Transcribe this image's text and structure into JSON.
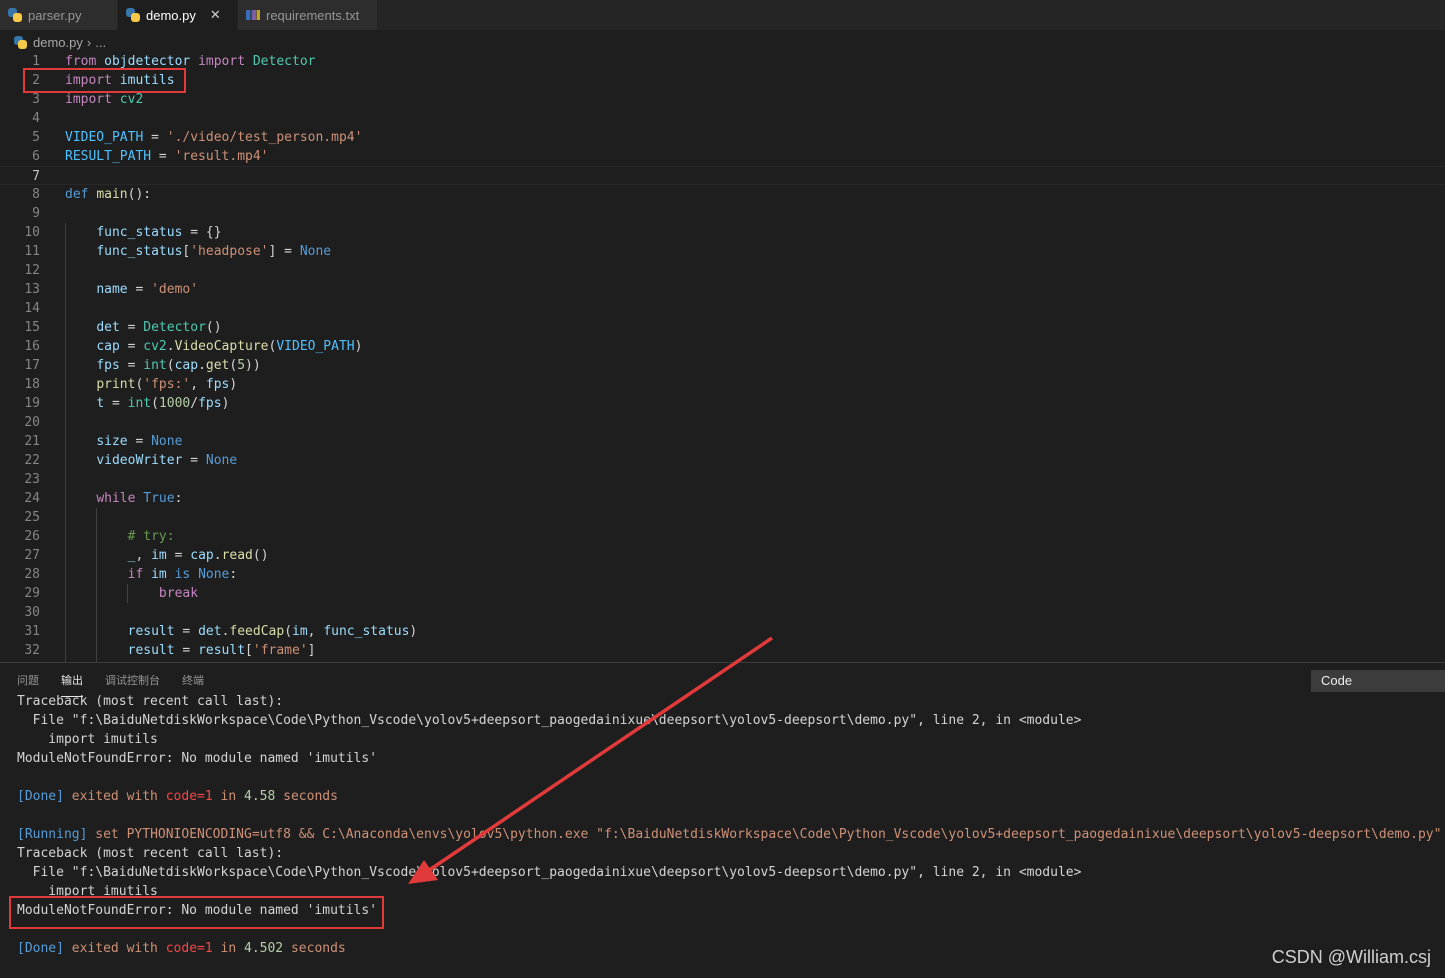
{
  "tabs": [
    {
      "label": "parser.py",
      "icon": "python-icon",
      "active": false
    },
    {
      "label": "demo.py",
      "icon": "python-icon",
      "active": true,
      "close": "✕"
    },
    {
      "label": "requirements.txt",
      "icon": "text-file-icon",
      "active": false
    }
  ],
  "breadcrumb": {
    "file": "demo.py",
    "separator": "›",
    "rest": "..."
  },
  "editor": {
    "current_line": 7,
    "lines": [
      {
        "n": "1",
        "tokens": [
          [
            "kw",
            "from"
          ],
          [
            "t",
            " "
          ],
          [
            "va",
            "objdetector"
          ],
          [
            "t",
            " "
          ],
          [
            "kw",
            "import"
          ],
          [
            "t",
            " "
          ],
          [
            "cl",
            "Detector"
          ]
        ]
      },
      {
        "n": "2",
        "tokens": [
          [
            "kw",
            "import"
          ],
          [
            "t",
            " "
          ],
          [
            "va",
            "imutils"
          ]
        ]
      },
      {
        "n": "3",
        "tokens": [
          [
            "kw",
            "import"
          ],
          [
            "t",
            " "
          ],
          [
            "cl",
            "cv2"
          ]
        ]
      },
      {
        "n": "4",
        "tokens": []
      },
      {
        "n": "5",
        "tokens": [
          [
            "co",
            "VIDEO_PATH"
          ],
          [
            "t",
            " = "
          ],
          [
            "st",
            "'./video/test_person.mp4'"
          ]
        ]
      },
      {
        "n": "6",
        "tokens": [
          [
            "co",
            "RESULT_PATH"
          ],
          [
            "t",
            " = "
          ],
          [
            "st",
            "'result.mp4'"
          ]
        ]
      },
      {
        "n": "7",
        "tokens": []
      },
      {
        "n": "8",
        "tokens": [
          [
            "kb",
            "def"
          ],
          [
            "t",
            " "
          ],
          [
            "fn",
            "main"
          ],
          [
            "t",
            "():"
          ]
        ]
      },
      {
        "n": "9",
        "tokens": []
      },
      {
        "n": "10",
        "tokens": [
          [
            "t",
            "    "
          ],
          [
            "va",
            "func_status"
          ],
          [
            "t",
            " = {}"
          ]
        ]
      },
      {
        "n": "11",
        "tokens": [
          [
            "t",
            "    "
          ],
          [
            "va",
            "func_status"
          ],
          [
            "t",
            "["
          ],
          [
            "st",
            "'headpose'"
          ],
          [
            "t",
            "] = "
          ],
          [
            "kb",
            "None"
          ]
        ]
      },
      {
        "n": "12",
        "tokens": []
      },
      {
        "n": "13",
        "tokens": [
          [
            "t",
            "    "
          ],
          [
            "va",
            "name"
          ],
          [
            "t",
            " = "
          ],
          [
            "st",
            "'demo'"
          ]
        ]
      },
      {
        "n": "14",
        "tokens": []
      },
      {
        "n": "15",
        "tokens": [
          [
            "t",
            "    "
          ],
          [
            "va",
            "det"
          ],
          [
            "t",
            " = "
          ],
          [
            "cl",
            "Detector"
          ],
          [
            "t",
            "()"
          ]
        ]
      },
      {
        "n": "16",
        "tokens": [
          [
            "t",
            "    "
          ],
          [
            "va",
            "cap"
          ],
          [
            "t",
            " = "
          ],
          [
            "cl",
            "cv2"
          ],
          [
            "t",
            "."
          ],
          [
            "fn",
            "VideoCapture"
          ],
          [
            "t",
            "("
          ],
          [
            "co",
            "VIDEO_PATH"
          ],
          [
            "t",
            ")"
          ]
        ]
      },
      {
        "n": "17",
        "tokens": [
          [
            "t",
            "    "
          ],
          [
            "va",
            "fps"
          ],
          [
            "t",
            " = "
          ],
          [
            "cl",
            "int"
          ],
          [
            "t",
            "("
          ],
          [
            "va",
            "cap"
          ],
          [
            "t",
            "."
          ],
          [
            "fn",
            "get"
          ],
          [
            "t",
            "("
          ],
          [
            "nu",
            "5"
          ],
          [
            "t",
            "))"
          ]
        ]
      },
      {
        "n": "18",
        "tokens": [
          [
            "t",
            "    "
          ],
          [
            "fn",
            "print"
          ],
          [
            "t",
            "("
          ],
          [
            "st",
            "'fps:'"
          ],
          [
            "t",
            ", "
          ],
          [
            "va",
            "fps"
          ],
          [
            "t",
            ")"
          ]
        ]
      },
      {
        "n": "19",
        "tokens": [
          [
            "t",
            "    "
          ],
          [
            "va",
            "t"
          ],
          [
            "t",
            " = "
          ],
          [
            "cl",
            "int"
          ],
          [
            "t",
            "("
          ],
          [
            "nu",
            "1000"
          ],
          [
            "t",
            "/"
          ],
          [
            "va",
            "fps"
          ],
          [
            "t",
            ")"
          ]
        ]
      },
      {
        "n": "20",
        "tokens": []
      },
      {
        "n": "21",
        "tokens": [
          [
            "t",
            "    "
          ],
          [
            "va",
            "size"
          ],
          [
            "t",
            " = "
          ],
          [
            "kb",
            "None"
          ]
        ]
      },
      {
        "n": "22",
        "tokens": [
          [
            "t",
            "    "
          ],
          [
            "va",
            "videoWriter"
          ],
          [
            "t",
            " = "
          ],
          [
            "kb",
            "None"
          ]
        ]
      },
      {
        "n": "23",
        "tokens": []
      },
      {
        "n": "24",
        "tokens": [
          [
            "t",
            "    "
          ],
          [
            "kw",
            "while"
          ],
          [
            "t",
            " "
          ],
          [
            "kb",
            "True"
          ],
          [
            "t",
            ":"
          ]
        ]
      },
      {
        "n": "25",
        "tokens": []
      },
      {
        "n": "26",
        "tokens": [
          [
            "t",
            "        "
          ],
          [
            "cm",
            "# try:"
          ]
        ]
      },
      {
        "n": "27",
        "tokens": [
          [
            "t",
            "        "
          ],
          [
            "va",
            "_"
          ],
          [
            "t",
            ", "
          ],
          [
            "va",
            "im"
          ],
          [
            "t",
            " = "
          ],
          [
            "va",
            "cap"
          ],
          [
            "t",
            "."
          ],
          [
            "fn",
            "read"
          ],
          [
            "t",
            "()"
          ]
        ]
      },
      {
        "n": "28",
        "tokens": [
          [
            "t",
            "        "
          ],
          [
            "kw",
            "if"
          ],
          [
            "t",
            " "
          ],
          [
            "va",
            "im"
          ],
          [
            "t",
            " "
          ],
          [
            "kb",
            "is"
          ],
          [
            "t",
            " "
          ],
          [
            "kb",
            "None"
          ],
          [
            "t",
            ":"
          ]
        ]
      },
      {
        "n": "29",
        "tokens": [
          [
            "t",
            "            "
          ],
          [
            "kw",
            "break"
          ]
        ]
      },
      {
        "n": "30",
        "tokens": []
      },
      {
        "n": "31",
        "tokens": [
          [
            "t",
            "        "
          ],
          [
            "va",
            "result"
          ],
          [
            "t",
            " = "
          ],
          [
            "va",
            "det"
          ],
          [
            "t",
            "."
          ],
          [
            "fn",
            "feedCap"
          ],
          [
            "t",
            "("
          ],
          [
            "va",
            "im"
          ],
          [
            "t",
            ", "
          ],
          [
            "va",
            "func_status"
          ],
          [
            "t",
            ")"
          ]
        ]
      },
      {
        "n": "32",
        "tokens": [
          [
            "t",
            "        "
          ],
          [
            "va",
            "result"
          ],
          [
            "t",
            " = "
          ],
          [
            "va",
            "result"
          ],
          [
            "t",
            "["
          ],
          [
            "st",
            "'frame'"
          ],
          [
            "t",
            "]"
          ]
        ]
      }
    ]
  },
  "panel": {
    "tabs": [
      "问题",
      "输出",
      "调试控制台",
      "终端"
    ],
    "active_tab": 1,
    "output_channel": "Code",
    "lines": [
      [
        [
          "t",
          "Traceback (most recent call last):"
        ]
      ],
      [
        [
          "t",
          "  File \"f:\\BaiduNetdiskWorkspace\\Code\\Python_Vscode\\yolov5+deepsort_paogedainixue\\deepsort\\yolov5-deepsort\\demo.py\", line 2, in <module>"
        ]
      ],
      [
        [
          "t",
          "    import imutils"
        ]
      ],
      [
        [
          "t",
          "ModuleNotFoundError: No module named 'imutils'"
        ]
      ],
      [],
      [
        [
          "otag",
          "[Done]"
        ],
        [
          "oexit",
          " exited with "
        ],
        [
          "ored",
          "code=1"
        ],
        [
          "oexit",
          " in "
        ],
        [
          "onum",
          "4.58"
        ],
        [
          "oexit",
          " seconds"
        ]
      ],
      [],
      [
        [
          "otag",
          "[Running]"
        ],
        [
          "oexit",
          " set PYTHONIOENCODING=utf8 && C:\\Anaconda\\envs\\yolov5\\python.exe \"f:\\BaiduNetdiskWorkspace\\Code\\Python_Vscode\\yolov5+deepsort_paogedainixue\\deepsort\\yolov5-deepsort\\demo.py\""
        ]
      ],
      [
        [
          "t",
          "Traceback (most recent call last):"
        ]
      ],
      [
        [
          "t",
          "  File \"f:\\BaiduNetdiskWorkspace\\Code\\Python_Vscode\\yolov5+deepsort_paogedainixue\\deepsort\\yolov5-deepsort\\demo.py\", line 2, in <module>"
        ]
      ],
      [
        [
          "t",
          "    import imutils"
        ]
      ],
      [
        [
          "t",
          "ModuleNotFoundError: No module named 'imutils'"
        ]
      ],
      [],
      [
        [
          "otag",
          "[Done]"
        ],
        [
          "oexit",
          " exited with "
        ],
        [
          "ored",
          "code=1"
        ],
        [
          "oexit",
          " in "
        ],
        [
          "onum",
          "4.502"
        ],
        [
          "oexit",
          " seconds"
        ]
      ]
    ]
  },
  "watermark": "CSDN @William.csj",
  "colors": {
    "annotation_red": "#e03a3a",
    "editor_bg": "#1e1e1e"
  }
}
